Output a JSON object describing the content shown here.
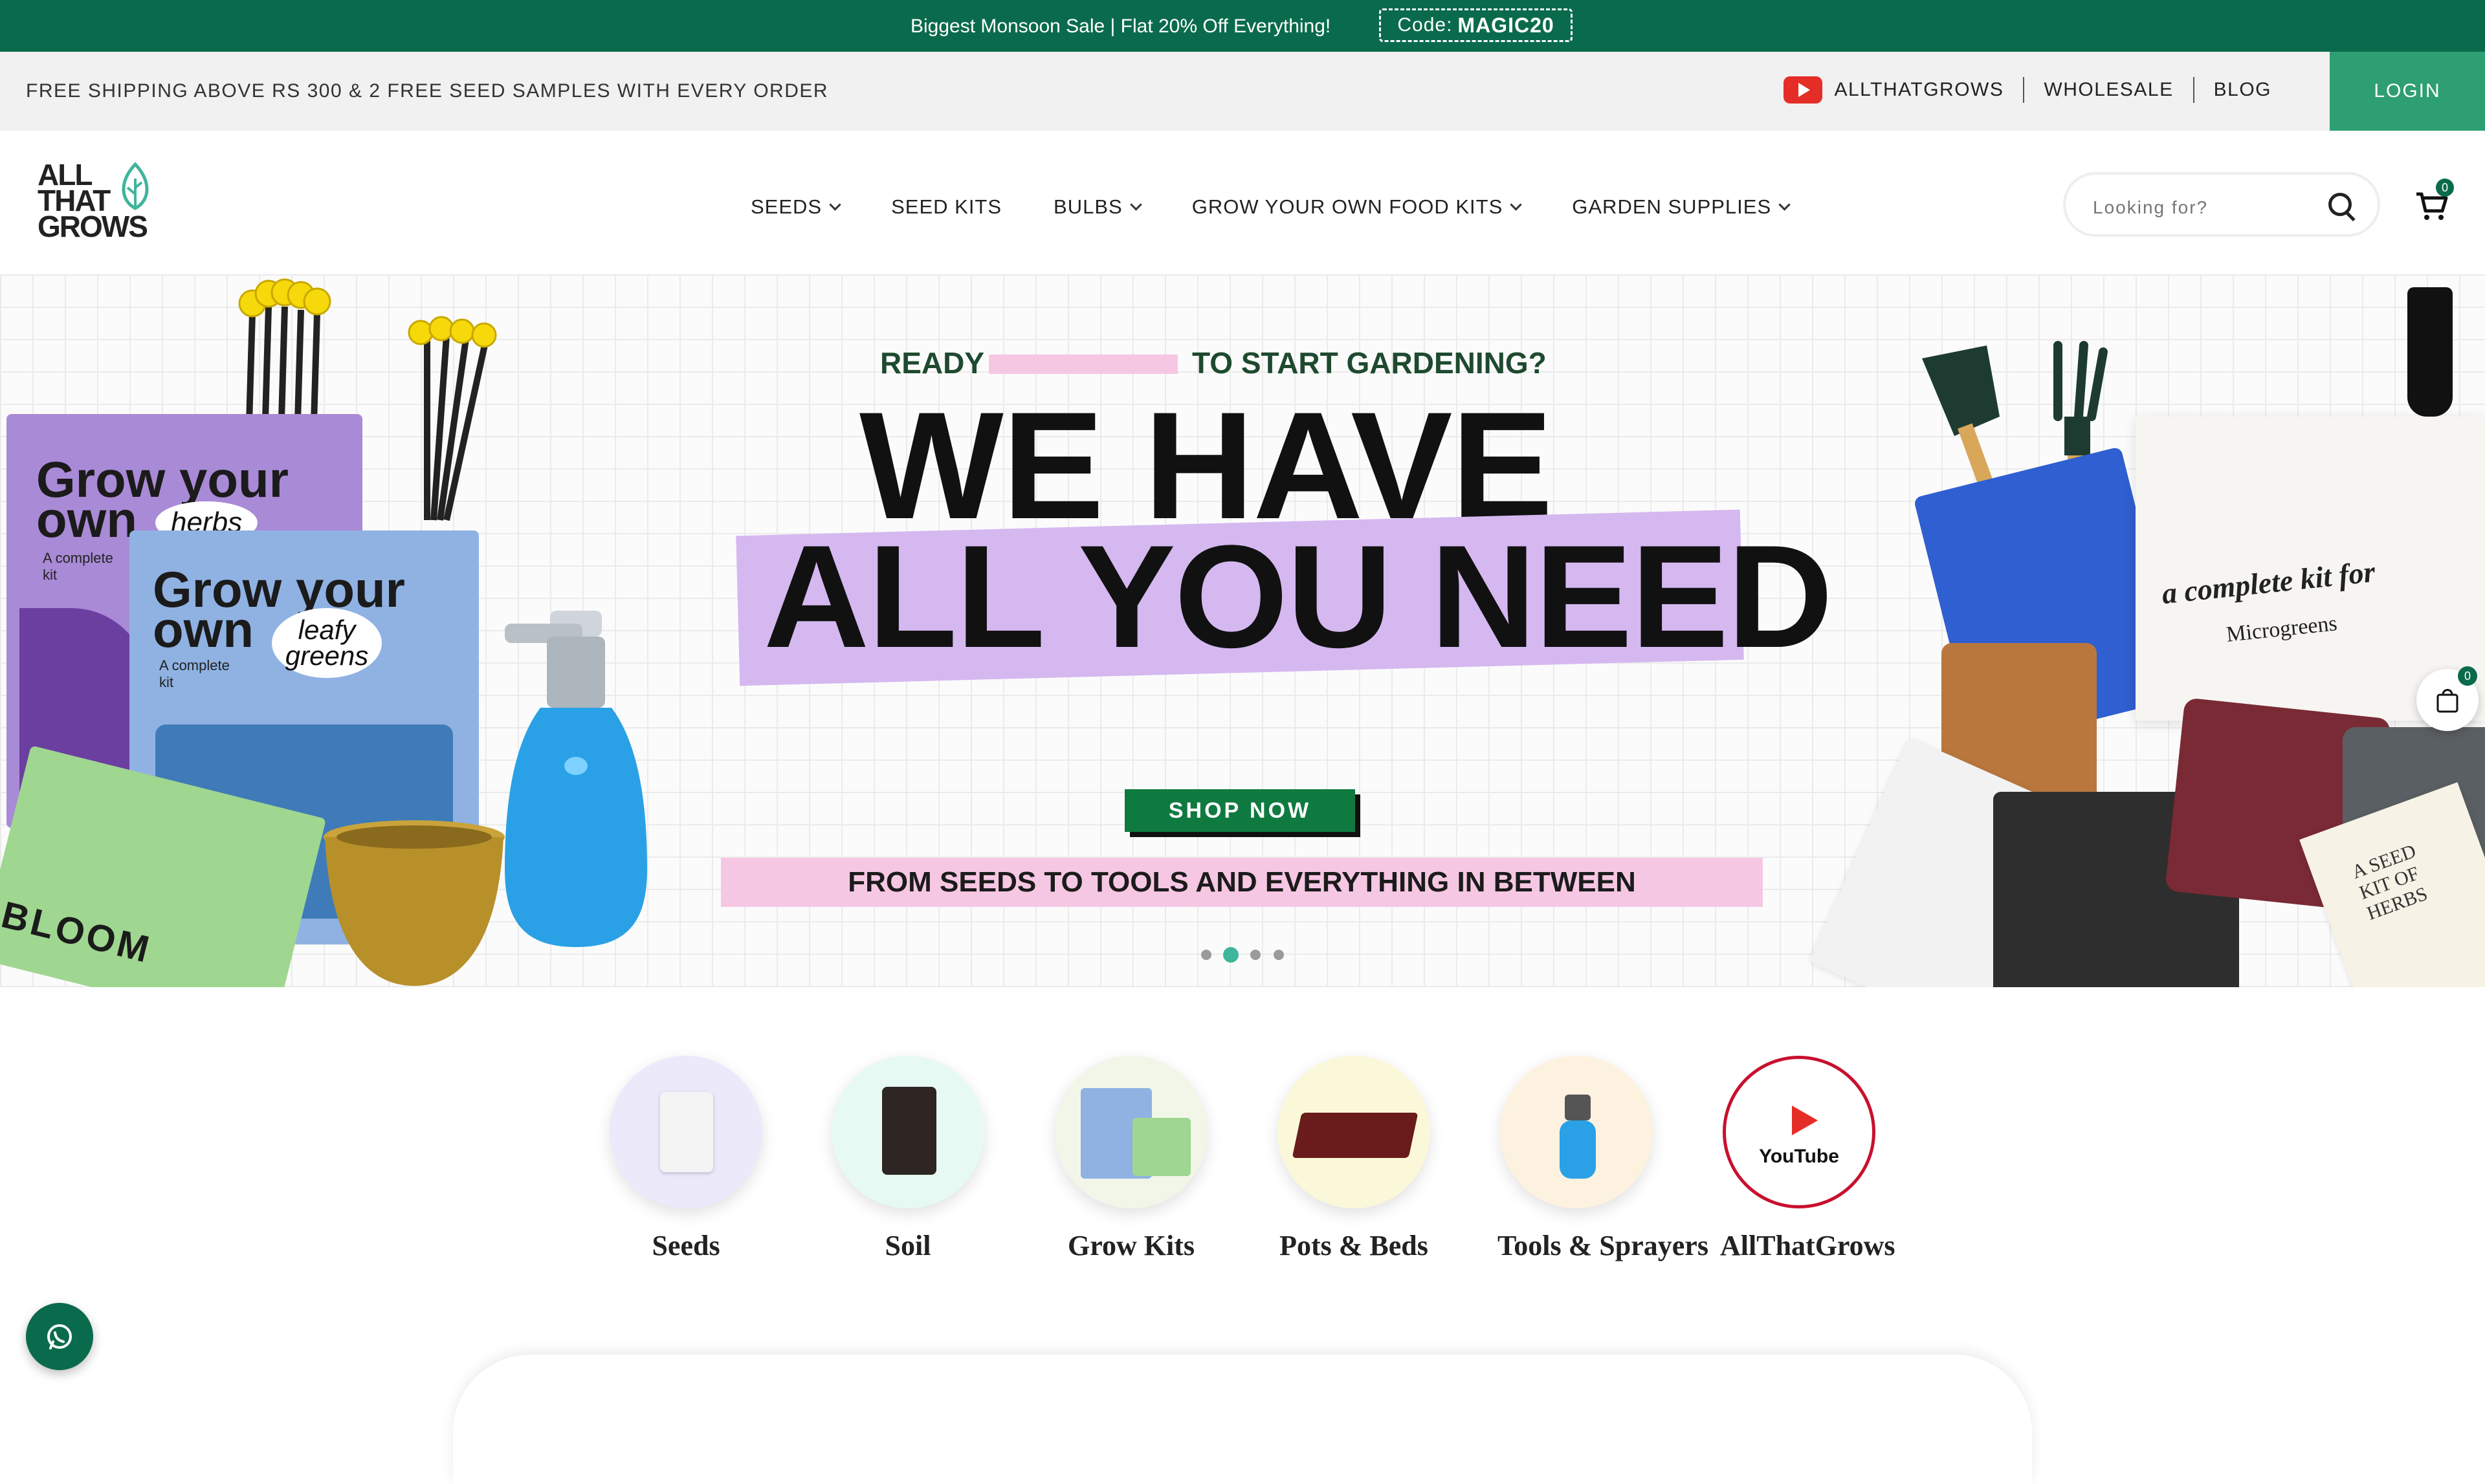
{
  "promo": {
    "text": "Biggest Monsoon Sale | Flat 20% Off Everything!",
    "code_prefix": "Code:",
    "code": "MAGIC20"
  },
  "info_bar": {
    "shipping": "FREE SHIPPING ABOVE RS 300 & 2 FREE SEED SAMPLES WITH EVERY ORDER",
    "youtube": "ALLTHATGROWS",
    "wholesale": "WHOLESALE",
    "blog": "BLOG",
    "login": "LOGIN"
  },
  "logo": {
    "line1": "ALL",
    "line2": "THAT",
    "line3": "GROWS"
  },
  "nav": [
    {
      "label": "SEEDS",
      "dropdown": true
    },
    {
      "label": "SEED KITS",
      "dropdown": false
    },
    {
      "label": "BULBS",
      "dropdown": true
    },
    {
      "label": "GROW YOUR OWN FOOD KITS",
      "dropdown": true
    },
    {
      "label": "GARDEN SUPPLIES",
      "dropdown": true
    }
  ],
  "search": {
    "placeholder": "Looking for?"
  },
  "cart": {
    "count": "0"
  },
  "hero": {
    "ready": "READY",
    "start": "TO START GARDENING?",
    "line1": "WE HAVE",
    "line2": "ALL YOU NEED",
    "cta": "SHOP NOW",
    "tagline": "FROM SEEDS TO TOOLS AND EVERYTHING IN BETWEEN",
    "box1_title": "Grow your own",
    "box1_sub": "A complete kit",
    "box1_burst": "herbs",
    "box2_title": "Grow your own",
    "box2_sub": "A complete kit",
    "box2_burst": "leafy greens",
    "green_box": "BLOOM",
    "kit_text": "a complete kit for",
    "kit_sub": "Microgreens",
    "seed_kit": "A SEED KIT OF HERBS",
    "slides_total": 4,
    "active_slide": 2
  },
  "mini_cart": {
    "count": "0"
  },
  "categories": [
    {
      "label": "Seeds",
      "bg": "#ece9fb"
    },
    {
      "label": "Soil",
      "bg": "#e6faf3"
    },
    {
      "label": "Grow Kits",
      "bg": "#f1f6e8"
    },
    {
      "label": "Pots & Beds",
      "bg": "#fbf8d9"
    },
    {
      "label": "Tools & Sprayers",
      "bg": "#fdf2df"
    },
    {
      "label": "AllThatGrows",
      "bg": "#ffffff",
      "inner": "YouTube"
    }
  ],
  "colors": {
    "brand_green": "#0a6b4c",
    "login_green": "#2e9f72",
    "hero_purple": "#d5b8f0",
    "hero_pink": "#f6c7e3",
    "youtube_red": "#e52d27"
  }
}
